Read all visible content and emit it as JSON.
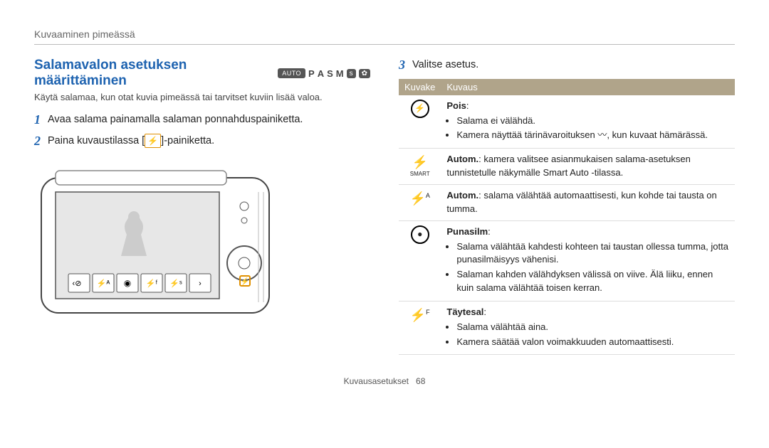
{
  "chapter": "Kuvaaminen pimeässä",
  "left": {
    "title": "Salamavalon asetuksen määrittäminen",
    "modes": {
      "auto": "AUTO",
      "p": "P",
      "a": "A",
      "s": "S",
      "m": "M",
      "extra1": "s",
      "extra2": "✿"
    },
    "intro": "Käytä salamaa, kun otat kuvia pimeässä tai tarvitset kuviin lisää valoa.",
    "step1_num": "1",
    "step1": "Avaa salama painamalla salaman ponnahduspainiketta.",
    "step2_num": "2",
    "step2_a": "Paina kuvaustilassa [",
    "step2_b": "]-painiketta.",
    "flash_glyph": "⚡"
  },
  "right": {
    "step3_num": "3",
    "step3": "Valitse asetus.",
    "th_icon": "Kuvake",
    "th_desc": "Kuvaus",
    "rows": [
      {
        "icon_kind": "off",
        "title": "Pois",
        "bullets": [
          "Salama ei välähdä.",
          "Kamera näyttää tärinävaroituksen 〰, kun kuvaat hämärässä."
        ]
      },
      {
        "icon_kind": "smart",
        "plain": "Autom.: kamera valitsee asianmukaisen salama-asetuksen tunnistetulle näkymälle Smart Auto -tilassa."
      },
      {
        "icon_kind": "auto",
        "plain": "Autom.: salama välähtää automaattisesti, kun kohde tai tausta on tumma."
      },
      {
        "icon_kind": "redeye",
        "title": "Punasilm",
        "bullets": [
          "Salama välähtää kahdesti kohteen tai taustan ollessa tumma, jotta punasilmäisyys vähenisi.",
          "Salaman kahden välähdyksen välissä on viive. Älä liiku, ennen kuin salama välähtää toisen kerran."
        ]
      },
      {
        "icon_kind": "fill",
        "title": "Täytesal",
        "bullets": [
          "Salama välähtää aina.",
          "Kamera säätää valon voimakkuuden automaattisesti."
        ]
      }
    ]
  },
  "footer": {
    "section": "Kuvausasetukset",
    "page": "68"
  }
}
